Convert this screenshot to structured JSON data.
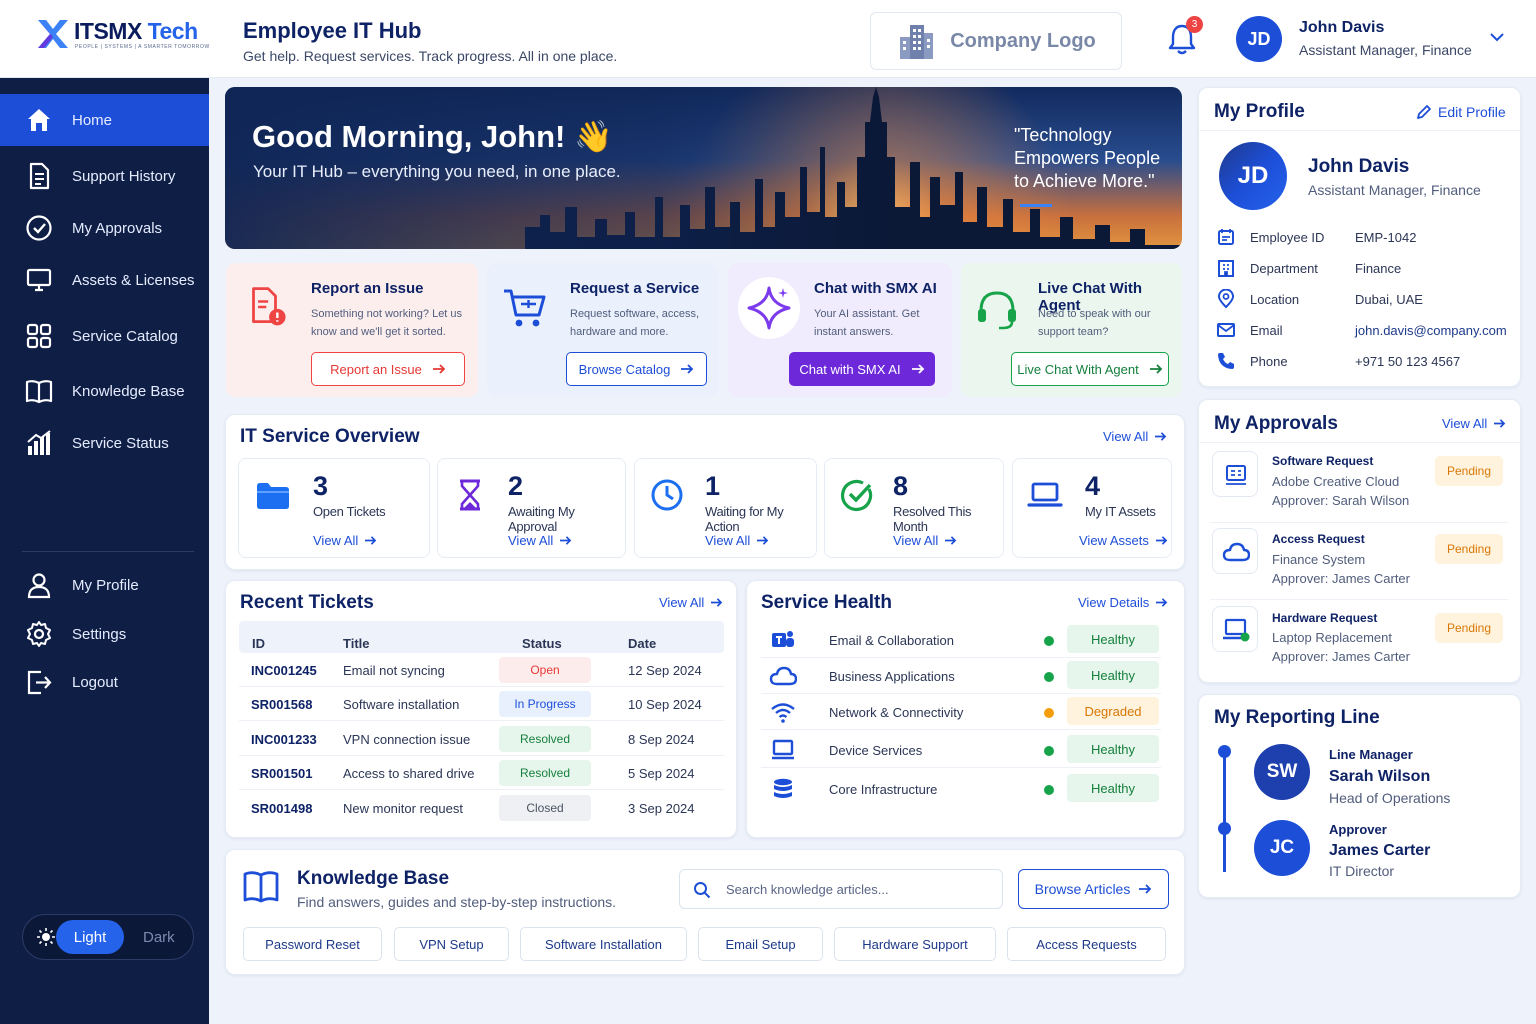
{
  "header": {
    "logo_text": "ITSMX",
    "logo_text_accent": "Tech",
    "logo_tagline": "PEOPLE | SYSTEMS | A SMARTER TOMORROW",
    "title": "Employee IT Hub",
    "subtitle": "Get help. Request services. Track progress. All in one place.",
    "company_logo": "Company Logo",
    "notification_count": "3",
    "user_initials": "JD",
    "user_name": "John Davis",
    "user_role": "Assistant Manager, Finance"
  },
  "sidebar": {
    "items": [
      {
        "label": "Home",
        "icon": "home-icon",
        "active": true
      },
      {
        "label": "Support History",
        "icon": "document-icon"
      },
      {
        "label": "My Approvals",
        "icon": "check-circle-icon"
      },
      {
        "label": "Assets & Licenses",
        "icon": "monitor-icon"
      },
      {
        "label": "Service Catalog",
        "icon": "grid-icon"
      },
      {
        "label": "Knowledge Base",
        "icon": "book-icon"
      },
      {
        "label": "Service Status",
        "icon": "bar-chart-icon"
      }
    ],
    "bottom_items": [
      {
        "label": "My Profile",
        "icon": "user-icon"
      },
      {
        "label": "Settings",
        "icon": "gear-icon"
      },
      {
        "label": "Logout",
        "icon": "logout-icon"
      }
    ],
    "theme": {
      "light": "Light",
      "dark": "Dark",
      "selected": "Light"
    }
  },
  "hero": {
    "greeting": "Good Morning, John! 👋",
    "subtitle": "Your IT Hub – everything you need, in one place.",
    "quote": "\"Technology Empowers People to Achieve More.\""
  },
  "quick_actions": [
    {
      "title": "Report an Issue",
      "desc": "Something not working? Let us know and we'll get it sorted.",
      "button": "Report an Issue",
      "icon": "alert-document-icon",
      "color": "#ef4444"
    },
    {
      "title": "Request a Service",
      "desc": "Request software, access, hardware and more.",
      "button": "Browse Catalog",
      "icon": "cart-icon",
      "color": "#1d4ed8"
    },
    {
      "title": "Chat with SMX AI",
      "desc": "Your AI assistant. Get instant answers.",
      "button": "Chat with SMX AI",
      "icon": "sparkle-icon",
      "color": "#6d28d9"
    },
    {
      "title": "Live Chat With Agent",
      "desc": "Need to speak with our support team?",
      "button": "Live Chat With Agent",
      "icon": "headset-icon",
      "color": "#16a34a"
    }
  ],
  "overview": {
    "title": "IT Service Overview",
    "view_all": "View All",
    "cards": [
      {
        "value": "3",
        "label": "Open Tickets",
        "link": "View All",
        "icon": "folder-icon"
      },
      {
        "value": "2",
        "label": "Awaiting My Approval",
        "link": "View All",
        "icon": "hourglass-icon"
      },
      {
        "value": "1",
        "label": "Waiting for My Action",
        "link": "View All",
        "icon": "clock-icon"
      },
      {
        "value": "8",
        "label": "Resolved This Month",
        "link": "View All",
        "icon": "check-circle-icon"
      },
      {
        "value": "4",
        "label": "My IT Assets",
        "link": "View Assets",
        "icon": "laptop-icon"
      }
    ]
  },
  "tickets": {
    "title": "Recent Tickets",
    "view_all": "View All",
    "columns": [
      "ID",
      "Title",
      "Status",
      "Date"
    ],
    "rows": [
      {
        "id": "INC001245",
        "title": "Email not syncing",
        "status": "Open",
        "date": "12 Sep 2024"
      },
      {
        "id": "SR001568",
        "title": "Software installation",
        "status": "In Progress",
        "date": "10 Sep 2024"
      },
      {
        "id": "INC001233",
        "title": "VPN connection issue",
        "status": "Resolved",
        "date": "8 Sep 2024"
      },
      {
        "id": "SR001501",
        "title": "Access to shared drive",
        "status": "Resolved",
        "date": "5 Sep 2024"
      },
      {
        "id": "SR001498",
        "title": "New monitor request",
        "status": "Closed",
        "date": "3 Sep 2024"
      }
    ]
  },
  "health": {
    "title": "Service Health",
    "view_details": "View Details",
    "rows": [
      {
        "name": "Email & Collaboration",
        "status": "Healthy",
        "icon": "teams-icon"
      },
      {
        "name": "Business Applications",
        "status": "Healthy",
        "icon": "cloud-icon"
      },
      {
        "name": "Network & Connectivity",
        "status": "Degraded",
        "icon": "wifi-icon"
      },
      {
        "name": "Device Services",
        "status": "Healthy",
        "icon": "monitor-icon"
      },
      {
        "name": "Core Infrastructure",
        "status": "Healthy",
        "icon": "database-icon"
      }
    ]
  },
  "knowledge": {
    "title": "Knowledge Base",
    "subtitle": "Find answers, guides and step-by-step instructions.",
    "search_placeholder": "Search knowledge articles...",
    "browse": "Browse Articles",
    "tags": [
      "Password Reset",
      "VPN Setup",
      "Software Installation",
      "Email Setup",
      "Hardware Support",
      "Access Requests"
    ]
  },
  "profile": {
    "title": "My Profile",
    "edit": "Edit Profile",
    "initials": "JD",
    "name": "John Davis",
    "role": "Assistant Manager, Finance",
    "fields": [
      {
        "label": "Employee ID",
        "value": "EMP-1042",
        "icon": "id-card-icon"
      },
      {
        "label": "Department",
        "value": "Finance",
        "icon": "building-icon"
      },
      {
        "label": "Location",
        "value": "Dubai, UAE",
        "icon": "location-icon"
      },
      {
        "label": "Email",
        "value": "john.davis@company.com",
        "icon": "mail-icon"
      },
      {
        "label": "Phone",
        "value": "+971 50 123 4567",
        "icon": "phone-icon"
      }
    ]
  },
  "approvals": {
    "title": "My Approvals",
    "view_all": "View All",
    "items": [
      {
        "title": "Software Request",
        "line1": "Adobe Creative Cloud",
        "line2": "Approver: Sarah Wilson",
        "status": "Pending",
        "icon": "app-window-icon"
      },
      {
        "title": "Access Request",
        "line1": "Finance System",
        "line2": "Approver: James Carter",
        "status": "Pending",
        "icon": "cloud-icon"
      },
      {
        "title": "Hardware Request",
        "line1": "Laptop Replacement",
        "line2": "Approver: James Carter",
        "status": "Pending",
        "icon": "laptop-icon"
      }
    ]
  },
  "reporting": {
    "title": "My Reporting Line",
    "people": [
      {
        "initials": "SW",
        "role": "Line Manager",
        "name": "Sarah Wilson",
        "title": "Head of Operations"
      },
      {
        "initials": "JC",
        "role": "Approver",
        "name": "James Carter",
        "title": "IT Director"
      }
    ]
  },
  "colors": {
    "primary": "#1d4ed8",
    "sidebar": "#0f1e45",
    "healthy": "#16a34a",
    "degraded": "#f59e0b",
    "open": "#ef4444",
    "ai": "#6d28d9"
  }
}
